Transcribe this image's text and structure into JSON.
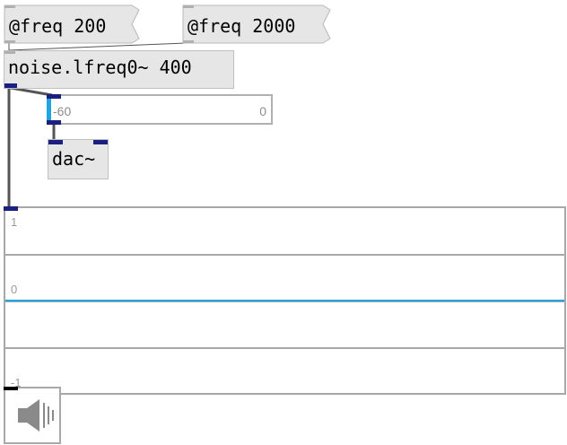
{
  "messages": {
    "freq_low": "@freq 200",
    "freq_high": "@freq 2000"
  },
  "objects": {
    "noise": "noise.lfreq0~ 400",
    "dac": "dac~"
  },
  "slider": {
    "min_label": "-60",
    "max_label": "0",
    "value_db": -60
  },
  "scope": {
    "top_label": "1",
    "mid_label": "0",
    "bottom_label": "-1",
    "signal_level": 0,
    "signal_color": "#1fa6e0"
  },
  "colors": {
    "port": "#1a1f80",
    "box_fill": "#e6e6e6",
    "accent": "#1fa6e0"
  },
  "icons": {
    "speaker": "speaker-icon"
  }
}
